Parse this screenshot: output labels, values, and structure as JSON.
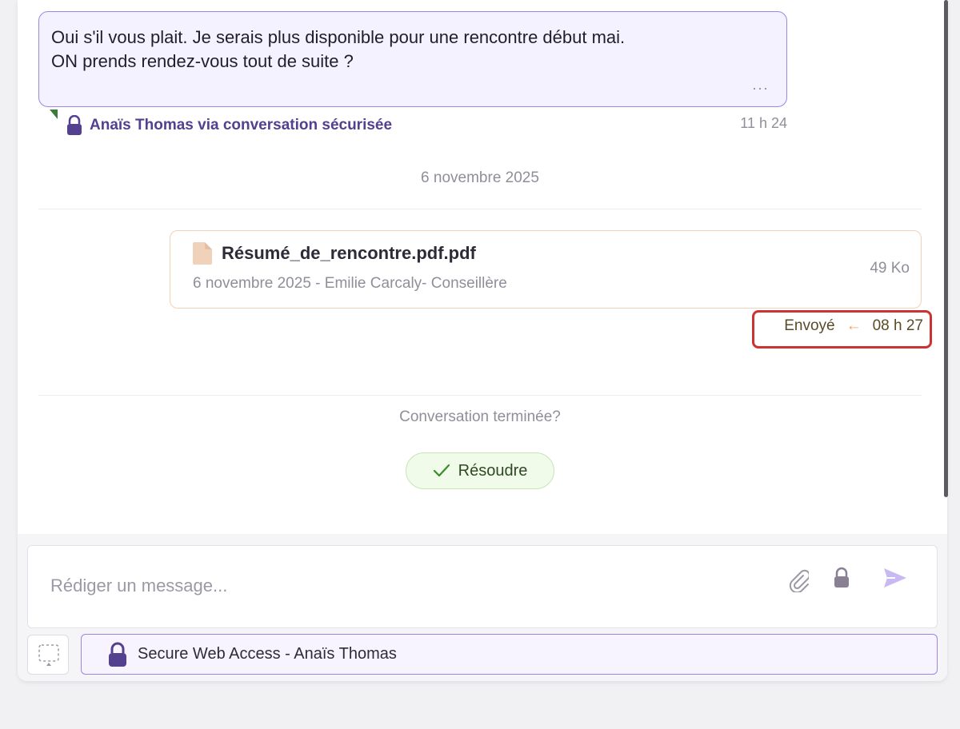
{
  "incoming_message": {
    "line1": "Oui s'il vous plait. Je serais plus disponible pour une rencontre début mai.",
    "line2": "ON prends rendez-vous tout de suite ?",
    "more_label": "···",
    "sender": "Anaïs Thomas via conversation sécurisée",
    "time": "11 h 24"
  },
  "date_separator": "6 novembre 2025",
  "attachment": {
    "name": "Résumé_de_rencontre.pdf.pdf",
    "meta": "6 novembre 2025 - Emilie Carcaly- Conseillère",
    "size": "49 Ko",
    "status": "Envoyé",
    "status_arrow": "←",
    "time": "08 h 27"
  },
  "resolution": {
    "question": "Conversation terminée?",
    "button_label": "Résoudre"
  },
  "composer": {
    "placeholder": "Rédiger un message...",
    "channel_label": "Secure Web Access - Anaïs Thomas"
  },
  "icons": {
    "sender": "lock-icon",
    "file": "file-icon",
    "status": "arrow-left-icon",
    "resolve": "check-icon",
    "attach": "paperclip-icon",
    "secure": "lock-icon",
    "send": "send-icon",
    "selection": "dashed-selection-icon",
    "channel": "lock-icon"
  },
  "colors": {
    "accent": "#53408f",
    "bubble_border": "#9b86e0",
    "file_border": "#efd2b9",
    "highlight": "#cc3333",
    "resolve_bg": "#f1fbe9"
  }
}
